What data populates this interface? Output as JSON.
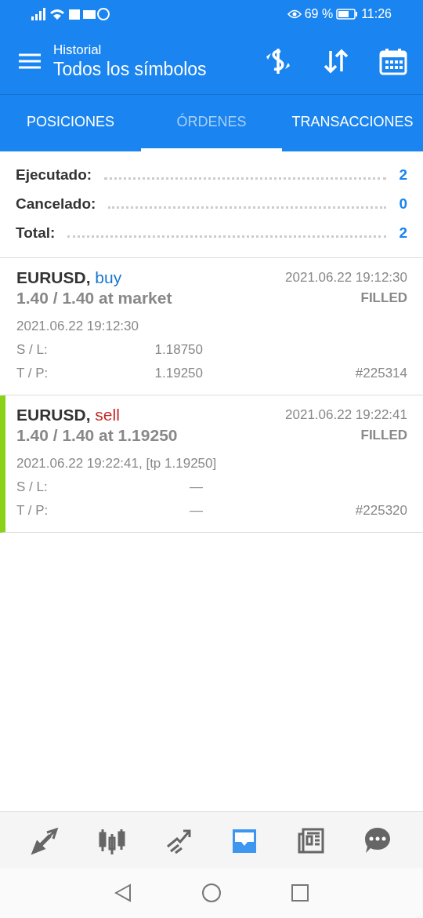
{
  "status_bar": {
    "battery": "69 %",
    "time": "11:26"
  },
  "header": {
    "subtitle": "Historial",
    "title": "Todos los símbolos"
  },
  "tabs": [
    {
      "label": "POSICIONES",
      "selected": false
    },
    {
      "label": "ÓRDENES",
      "selected": true
    },
    {
      "label": "TRANSACCIONES",
      "selected": false
    }
  ],
  "summary": [
    {
      "label": "Ejecutado:",
      "value": "2"
    },
    {
      "label": "Cancelado:",
      "value": "0"
    },
    {
      "label": "Total:",
      "value": "2"
    }
  ],
  "orders": [
    {
      "symbol": "EURUSD,",
      "side": "buy",
      "color": "#1976d2",
      "volume": "1.40 / 1.40 at market",
      "time": "2021.06.22 19:12:30",
      "status": "FILLED",
      "detail": "2021.06.22 19:12:30",
      "sl_label": "S / L:",
      "sl": "1.18750",
      "tp_label": "T / P:",
      "tp": "1.19250",
      "ticket": "#225314",
      "selected": false
    },
    {
      "symbol": "EURUSD,",
      "side": "sell",
      "color": "#c62828",
      "volume": "1.40 / 1.40 at 1.19250",
      "time": "2021.06.22 19:22:41",
      "status": "FILLED",
      "detail": "2021.06.22 19:22:41, [tp 1.19250]",
      "sl_label": "S / L:",
      "sl": "—",
      "tp_label": "T / P:",
      "tp": "—",
      "ticket": "#225320",
      "selected": true
    }
  ],
  "bottom_nav": [
    {
      "kind": "quotes",
      "selected": false
    },
    {
      "kind": "chart",
      "selected": false
    },
    {
      "kind": "trade",
      "selected": false
    },
    {
      "kind": "history",
      "selected": true
    },
    {
      "kind": "news",
      "selected": false
    },
    {
      "kind": "chat",
      "selected": false
    }
  ]
}
